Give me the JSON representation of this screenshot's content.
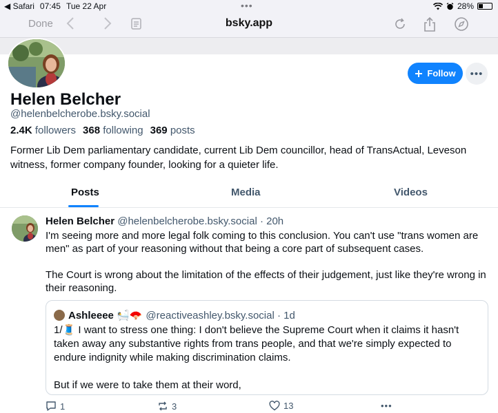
{
  "status_bar": {
    "back_app": "◀ Safari",
    "time": "07:45",
    "date": "Tue 22 Apr",
    "dots": "•••",
    "battery": "28%"
  },
  "browser": {
    "done_label": "Done",
    "url": "bsky.app"
  },
  "profile": {
    "name": "Helen Belcher",
    "handle": "@helenbelcherobe.bsky.social",
    "followers_count": "2.4K",
    "followers_label": "followers",
    "following_count": "368",
    "following_label": "following",
    "posts_count": "369",
    "posts_label": "posts",
    "bio": "Former Lib Dem parliamentary candidate, current Lib Dem councillor, head of TransActual, Leveson witness, former company founder, looking for a quieter life.",
    "follow_label": "Follow",
    "more_label": "•••"
  },
  "tabs": [
    {
      "label": "Posts",
      "active": true
    },
    {
      "label": "Media",
      "active": false
    },
    {
      "label": "Videos",
      "active": false
    }
  ],
  "post": {
    "author_name": "Helen Belcher",
    "author_handle": "@helenbelcherobe.bsky.social · 20h",
    "paragraphs": [
      "I'm seeing more and more legal folk coming to this conclusion. You can't use \"trans women are men\" as part of your reasoning without that being a core part of subsequent cases.",
      "The Court is wrong about the limitation of the effects of their judgement, just like they're wrong in their reasoning."
    ],
    "quote": {
      "author_name": "Ashleeee 🛀🪭",
      "author_handle": "@reactiveashley.bsky.social · 1d",
      "paragraphs": [
        "1/🧵 I want to stress one thing: I don't believe the Supreme Court when it claims it hasn't taken away any substantive rights from trans people, and that we're simply expected to endure indignity while making discrimination claims.",
        "But if we were to take them at their word,"
      ]
    },
    "reply_count": "1",
    "repost_count": "3",
    "like_count": "13",
    "more_label": "•••"
  },
  "colors": {
    "accent": "#1083fe",
    "secondary_text": "#42576c",
    "border": "#d4dbe2"
  }
}
